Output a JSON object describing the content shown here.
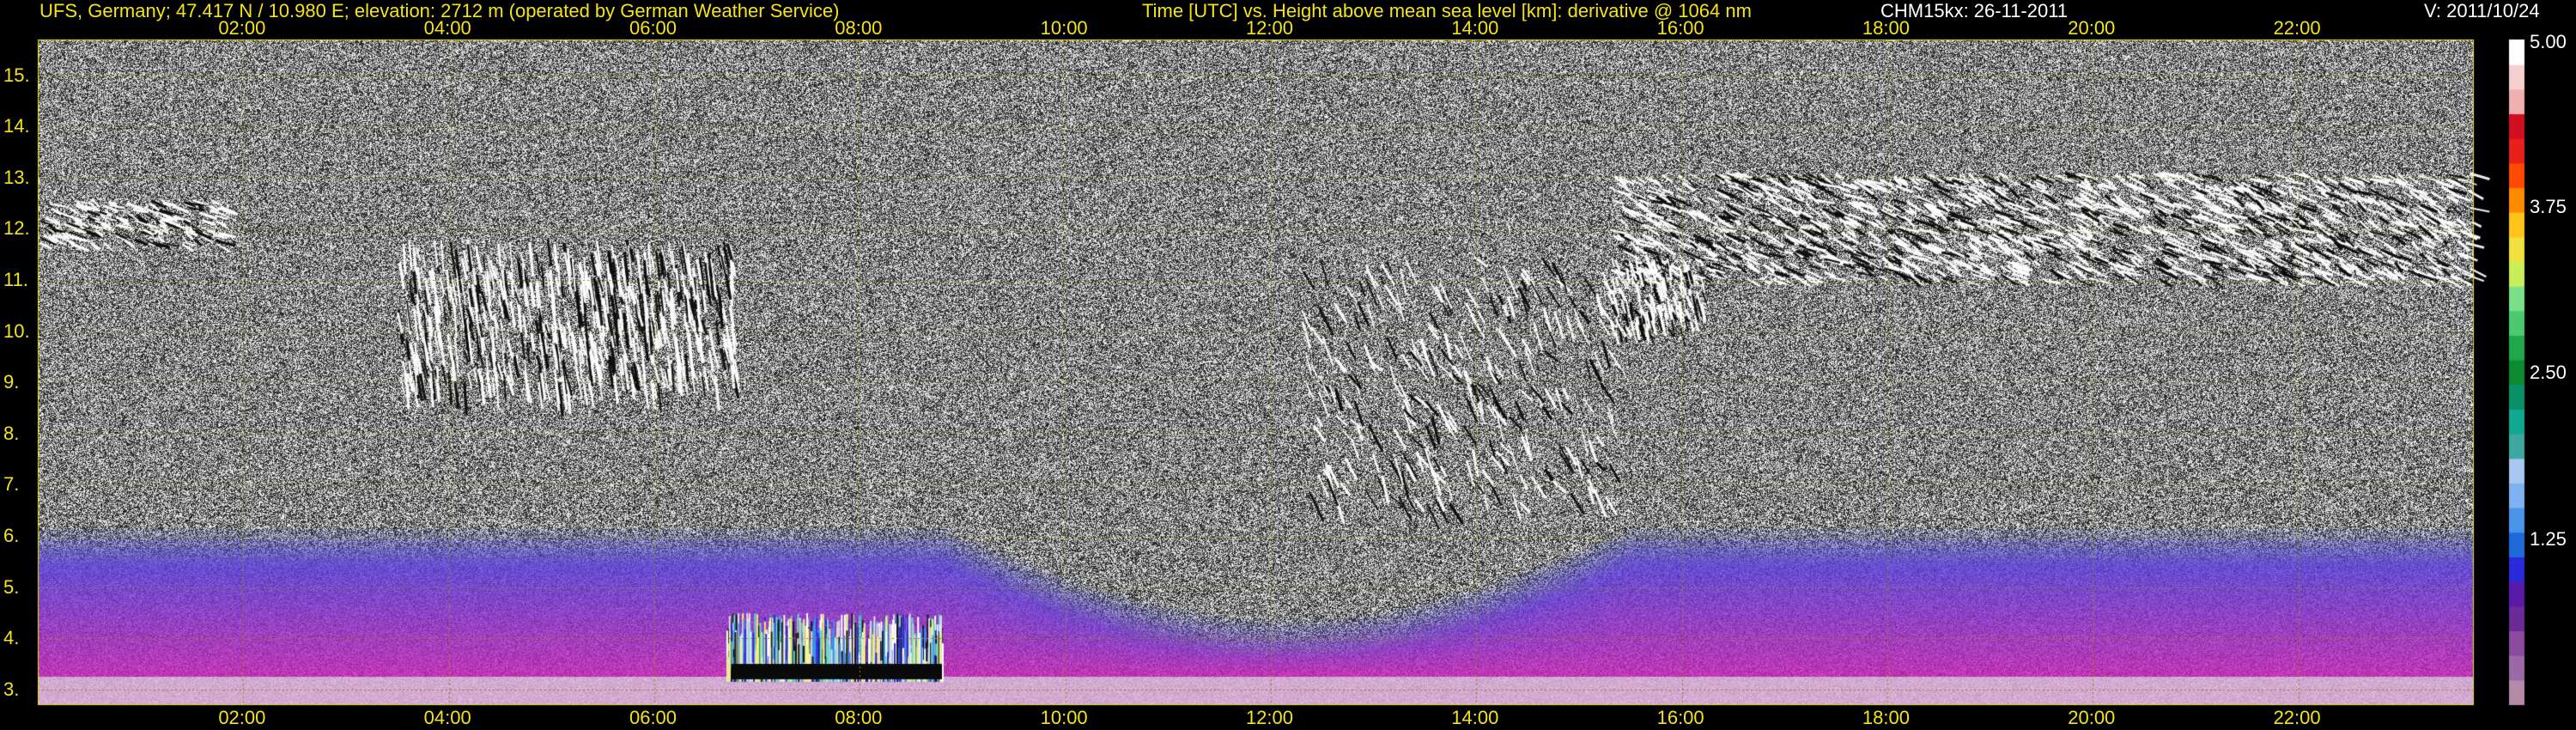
{
  "header": {
    "station": "UFS, Germany; 47.417 N / 10.980 E; elevation: 2712 m  (operated by German Weather Service)",
    "description": "Time [UTC] vs. Height above mean sea level [km]: derivative @ 1064 nm",
    "instrument": "CHM15kx: 26-11-2011",
    "version": "V: 2011/10/24"
  },
  "chart_data": {
    "type": "heatmap",
    "title": "Time [UTC] vs. Height above mean sea level [km]: derivative @ 1064 nm",
    "x_ticks": [
      "02:00",
      "04:00",
      "06:00",
      "08:00",
      "10:00",
      "12:00",
      "14:00",
      "16:00",
      "18:00",
      "20:00",
      "22:00"
    ],
    "x_tick_hours": [
      2,
      4,
      6,
      8,
      10,
      12,
      14,
      16,
      18,
      20,
      22
    ],
    "xlim": [
      0,
      23.7
    ],
    "y_ticks": [
      "3.",
      "4.",
      "5.",
      "6.",
      "7.",
      "8.",
      "9.",
      "10.",
      "11.",
      "12.",
      "13.",
      "14.",
      "15."
    ],
    "y_tick_values": [
      3,
      4,
      5,
      6,
      7,
      8,
      9,
      10,
      11,
      12,
      13,
      14,
      15
    ],
    "ylim": [
      2.712,
      15.7
    ],
    "grid": true,
    "colorbar": {
      "ticks": [
        "1.25",
        "2.50",
        "3.75",
        "5.00"
      ],
      "tick_values": [
        1.25,
        2.5,
        3.75,
        5.0
      ],
      "range": [
        0,
        5.0
      ]
    },
    "features": [
      {
        "name": "cirrus-left",
        "x": [
          0.0,
          1.8
        ],
        "y": [
          11.7,
          12.6
        ]
      },
      {
        "name": "cirrus-fallstreaks-1",
        "x": [
          3.5,
          6.8
        ],
        "y": [
          8.5,
          11.8
        ]
      },
      {
        "name": "cirrus-descending",
        "x": [
          12.3,
          15.3
        ],
        "y": [
          6.5,
          12.0
        ]
      },
      {
        "name": "cirrus-right",
        "x": [
          15.3,
          23.7
        ],
        "y": [
          10.0,
          13.1
        ]
      },
      {
        "name": "fog-layer",
        "x": [
          6.7,
          8.8
        ],
        "y": [
          3.0,
          4.5
        ]
      },
      {
        "name": "aerosol-boundary-layer",
        "x": [
          0,
          23.7
        ],
        "y": [
          2.712,
          6.0
        ]
      }
    ],
    "colors": {
      "background_text": "#f3e418",
      "grid": "#8c8a14",
      "low": "#b48aa8",
      "mid": "#1d6ad8",
      "high": "#ffffff"
    }
  }
}
